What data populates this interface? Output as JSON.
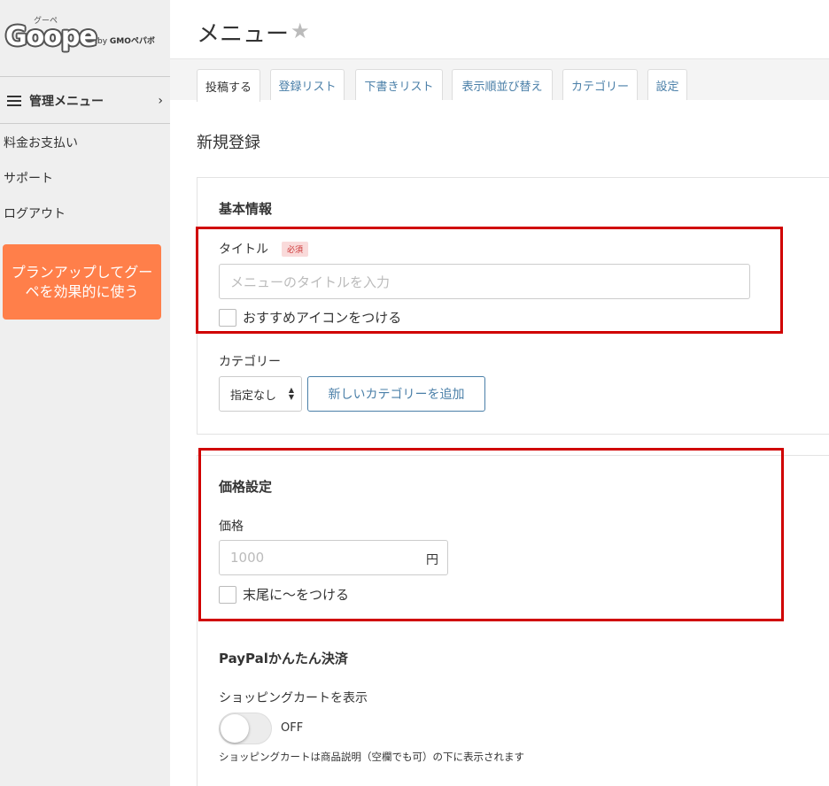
{
  "sidebar": {
    "logo": {
      "wordmark": "Goope",
      "kana": "グーペ",
      "by": "by",
      "company": "GMOペパボ"
    },
    "menu_header": "管理メニュー",
    "links": [
      "料金お支払い",
      "サポート",
      "ログアウト"
    ],
    "plan_button": "プランアップしてグーペを効果的に使う"
  },
  "header": {
    "title": "メニュー",
    "star_icon": "star-icon"
  },
  "tabs": [
    {
      "label": "投稿する",
      "active": true
    },
    {
      "label": "登録リスト"
    },
    {
      "label": "下書きリスト"
    },
    {
      "label": "表示順並び替え"
    },
    {
      "label": "カテゴリー"
    },
    {
      "label": "設定"
    }
  ],
  "main": {
    "heading": "新規登録",
    "basic": {
      "title": "基本情報",
      "title_label": "タイトル",
      "required_badge": "必須",
      "title_placeholder": "メニューのタイトルを入力",
      "recommend_checkbox": "おすすめアイコンをつける",
      "category_label": "カテゴリー",
      "category_select_value": "指定なし",
      "add_category_button": "新しいカテゴリーを追加"
    },
    "price": {
      "title": "価格設定",
      "price_label": "価格",
      "price_placeholder": "1000",
      "unit": "円",
      "tilde_checkbox": "末尾に〜をつける"
    },
    "paypal": {
      "title": "PayPalかんたん決済",
      "cart_label": "ショッピングカートを表示",
      "toggle_state": "OFF",
      "help": "ショッピングカートは商品説明（空欄でも可）の下に表示されます"
    }
  },
  "colors": {
    "sidebar_bg": "#efefef",
    "plan_button": "#ff7f4a",
    "link_blue": "#4a7fa8",
    "highlight_red": "#d00000"
  }
}
